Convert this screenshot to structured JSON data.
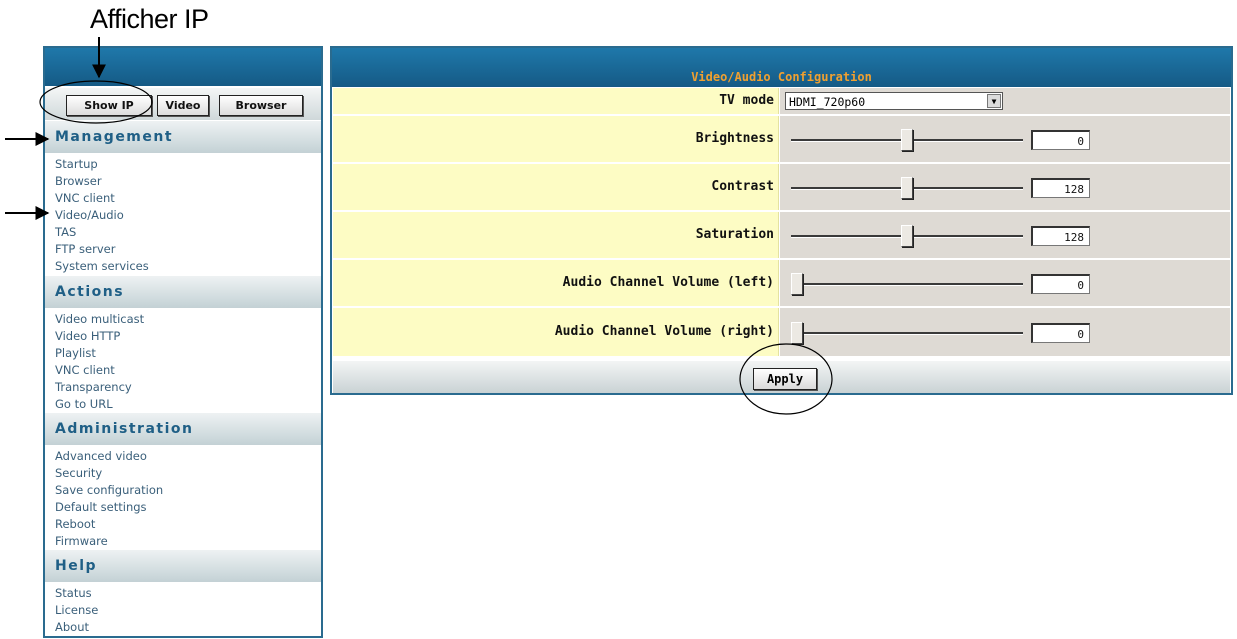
{
  "annotation": {
    "title": "Afficher IP"
  },
  "sidebar": {
    "buttons": [
      {
        "label": "Show IP"
      },
      {
        "label": "Video"
      },
      {
        "label": "Browser"
      }
    ],
    "sections": [
      {
        "title": "Management",
        "items": [
          "Startup",
          "Browser",
          "VNC client",
          "Video/Audio",
          "TAS",
          "FTP server",
          "System services"
        ]
      },
      {
        "title": "Actions",
        "items": [
          "Video multicast",
          "Video HTTP",
          "Playlist",
          "VNC client",
          "Transparency",
          "Go to URL"
        ]
      },
      {
        "title": "Administration",
        "items": [
          "Advanced video",
          "Security",
          "Save configuration",
          "Default settings",
          "Reboot",
          "Firmware"
        ]
      },
      {
        "title": "Help",
        "items": [
          "Status",
          "License",
          "About"
        ]
      }
    ]
  },
  "panel": {
    "title": "Video/Audio Configuration",
    "tv_mode": {
      "label": "TV mode",
      "value": "HDMI_720p60"
    },
    "sliders": [
      {
        "label": "Brightness",
        "value": "0",
        "level": 0.5
      },
      {
        "label": "Contrast",
        "value": "128",
        "level": 0.5
      },
      {
        "label": "Saturation",
        "value": "128",
        "level": 0.5
      },
      {
        "label": "Audio Channel Volume (left)",
        "value": "0",
        "level": 0.0
      },
      {
        "label": "Audio Channel Volume (right)",
        "value": "0",
        "level": 0.0
      }
    ],
    "apply_label": "Apply"
  },
  "colors": {
    "header_blue": "#1f78aa",
    "title_orange": "#f0a030",
    "label_bg_yellow": "#fdfcc4",
    "section_text": "#1f5f86",
    "link_text": "#3a5f7a"
  }
}
